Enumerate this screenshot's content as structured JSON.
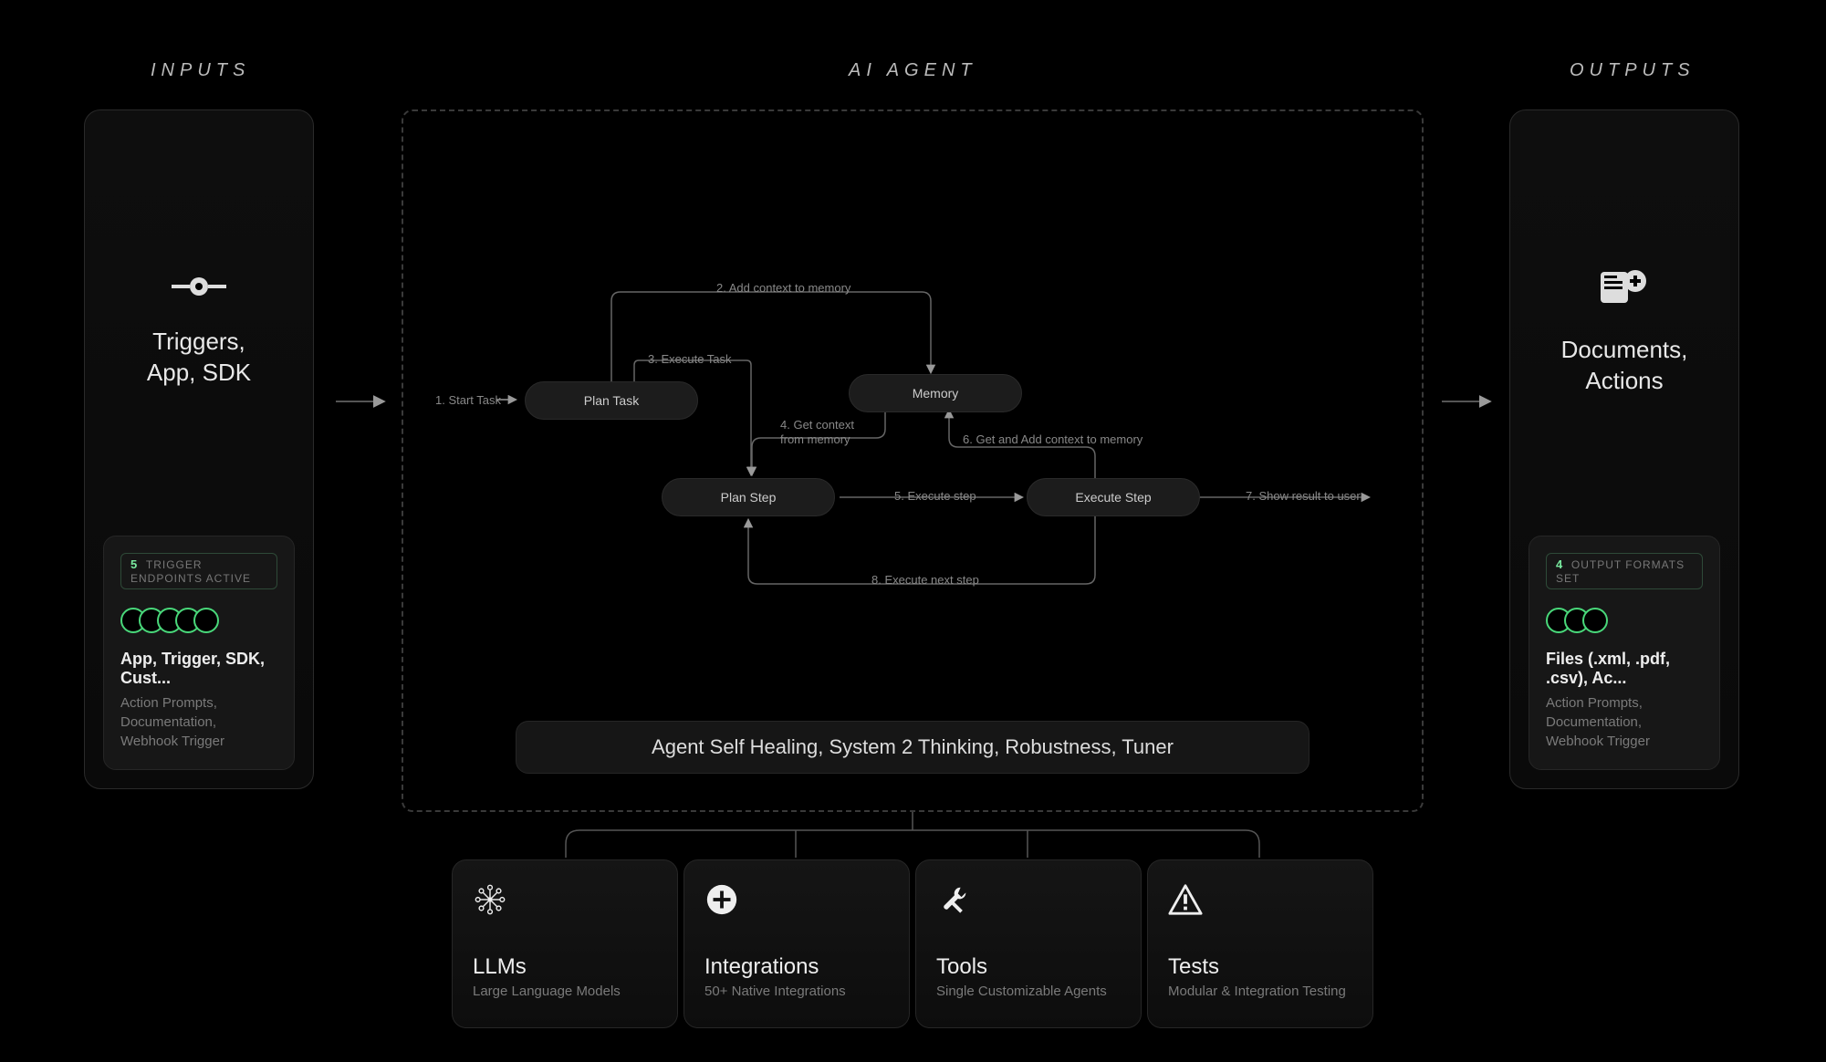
{
  "sections": {
    "inputs": "INPUTS",
    "agent": "AI AGENT",
    "outputs": "OUTPUTS"
  },
  "inputs_panel": {
    "title": "Triggers,\nApp, SDK",
    "badge_count": "5",
    "badge_label": "TRIGGER ENDPOINTS ACTIVE",
    "dot_count": 5,
    "status_line1": "App, Trigger, SDK, Cust...",
    "status_line2": "Action Prompts, Documentation, Webhook Trigger"
  },
  "outputs_panel": {
    "title": "Documents,\nActions",
    "badge_count": "4",
    "badge_label": "OUTPUT FORMATS SET",
    "dot_count": 3,
    "status_line1": "Files (.xml, .pdf, .csv), Ac...",
    "status_line2": "Action Prompts, Documentation, Webhook Trigger"
  },
  "flow": {
    "start_label": "1.  Start Task",
    "plan_task": "Plan Task",
    "memory": "Memory",
    "plan_step": "Plan Step",
    "execute_step": "Execute Step",
    "edge2": "2. Add context to memory",
    "edge3": "3. Execute Task",
    "edge4": "4. Get context\nfrom memory",
    "edge5": "5.  Execute step",
    "edge6": "6. Get and Add context to memory",
    "edge7": "7.  Show result to user",
    "edge8": "8. Execute next step"
  },
  "bottom_bar": "Agent Self Healing, System 2 Thinking, Robustness, Tuner",
  "capabilities": [
    {
      "title": "LLMs",
      "sub": "Large Language Models",
      "icon": "network"
    },
    {
      "title": "Integrations",
      "sub": "50+ Native Integrations",
      "icon": "plus"
    },
    {
      "title": "Tools",
      "sub": "Single Customizable Agents",
      "icon": "tools"
    },
    {
      "title": "Tests",
      "sub": "Modular & Integration Testing",
      "icon": "warning"
    }
  ]
}
